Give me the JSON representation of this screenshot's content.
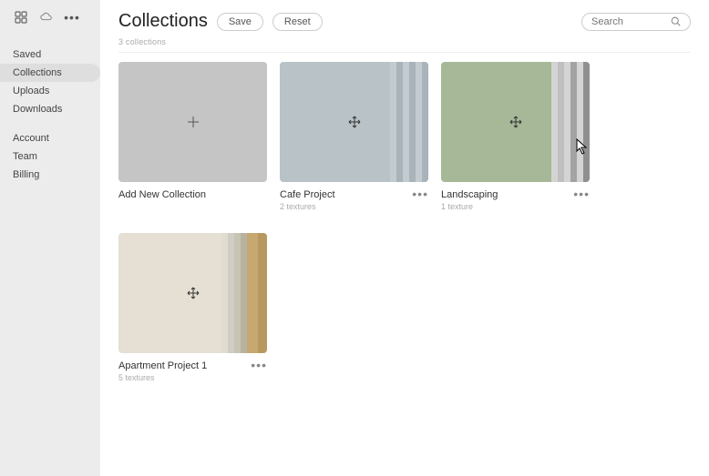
{
  "sidebar": {
    "group1": [
      {
        "label": "Saved",
        "active": false
      },
      {
        "label": "Collections",
        "active": true
      },
      {
        "label": "Uploads",
        "active": false
      },
      {
        "label": "Downloads",
        "active": false
      }
    ],
    "group2": [
      {
        "label": "Account"
      },
      {
        "label": "Team"
      },
      {
        "label": "Billing"
      }
    ]
  },
  "header": {
    "title": "Collections",
    "save_label": "Save",
    "reset_label": "Reset"
  },
  "search": {
    "placeholder": "Search"
  },
  "summary": "3 collections",
  "cards": {
    "add": {
      "title": "Add New Collection"
    },
    "c1": {
      "title": "Cafe Project",
      "sub": "2 textures"
    },
    "c2": {
      "title": "Landscaping",
      "sub": "1 texture"
    },
    "c3": {
      "title": "Apartment Project 1",
      "sub": "5 textures"
    }
  },
  "colors": {
    "c1_stripes": [
      "#c3cbd0",
      "#a9b3b9",
      "#c3cbd0",
      "#a9b3b9",
      "#c3cbd0",
      "#a9b3b9"
    ],
    "c2_stripes": [
      "#d4d4d4",
      "#bfbfbf",
      "#d4d4d4",
      "#a3a3a3",
      "#d4d4d4",
      "#8f8f8f"
    ],
    "c3_stripes": [
      "#d0cec4",
      "#c7c3b5",
      "#b8b3a0",
      "#c6a870",
      "#b79960"
    ]
  }
}
